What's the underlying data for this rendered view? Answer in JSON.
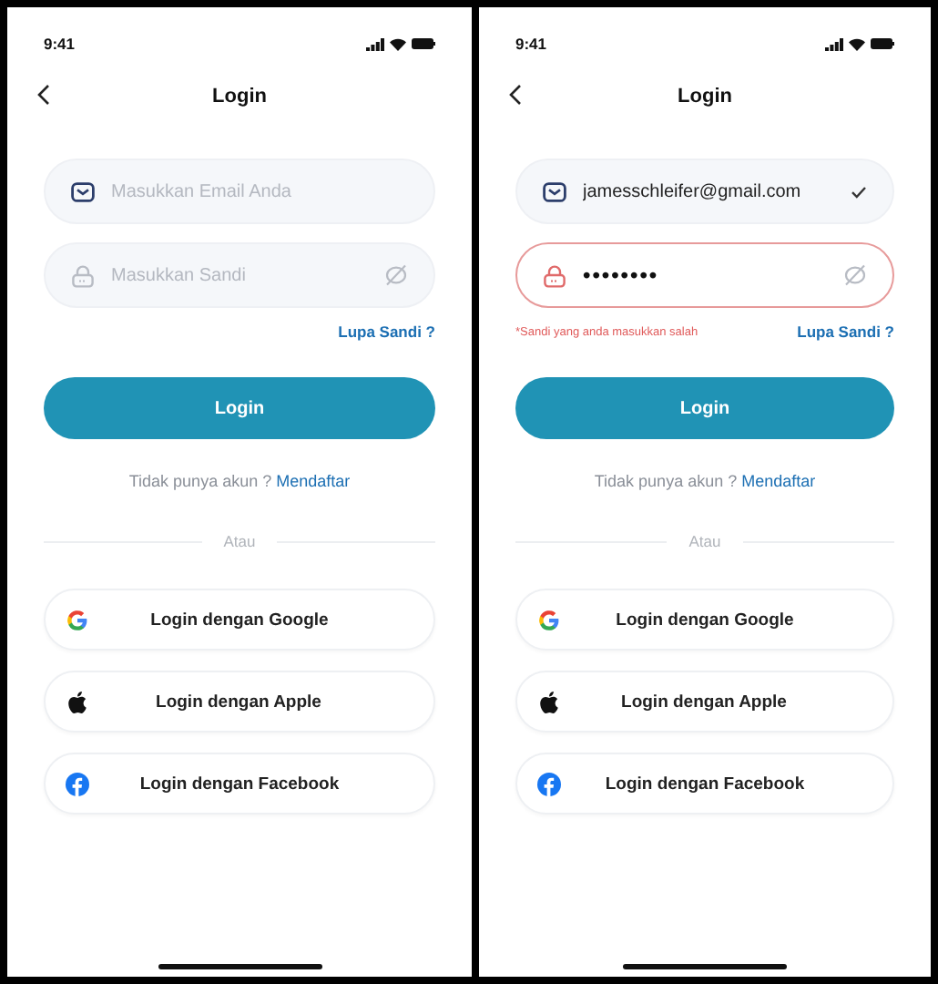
{
  "screens": [
    {
      "status_time": "9:41",
      "title": "Login",
      "email": {
        "placeholder": "Masukkan Email Anda",
        "valid": false
      },
      "password": {
        "placeholder": "Masukkan Sandi",
        "error": false
      },
      "forgot_link": "Lupa Sandi ?",
      "login_button": "Login",
      "signup_prompt": "Tidak punya akun ?",
      "signup_link": "Mendaftar",
      "divider": "Atau",
      "social_buttons": [
        {
          "kind": "google",
          "label": "Login dengan Google"
        },
        {
          "kind": "apple",
          "label": "Login dengan Apple"
        },
        {
          "kind": "facebook",
          "label": "Login dengan Facebook"
        }
      ]
    },
    {
      "status_time": "9:41",
      "title": "Login",
      "email": {
        "value": "jamesschleifer@gmail.com",
        "valid": true
      },
      "password": {
        "value": "••••••••",
        "error": true
      },
      "error_message": "*Sandi yang anda masukkan salah",
      "forgot_link": "Lupa Sandi ?",
      "login_button": "Login",
      "signup_prompt": "Tidak punya akun ?",
      "signup_link": "Mendaftar",
      "divider": "Atau",
      "social_buttons": [
        {
          "kind": "google",
          "label": "Login dengan Google"
        },
        {
          "kind": "apple",
          "label": "Login dengan Apple"
        },
        {
          "kind": "facebook",
          "label": "Login dengan Facebook"
        }
      ]
    }
  ]
}
